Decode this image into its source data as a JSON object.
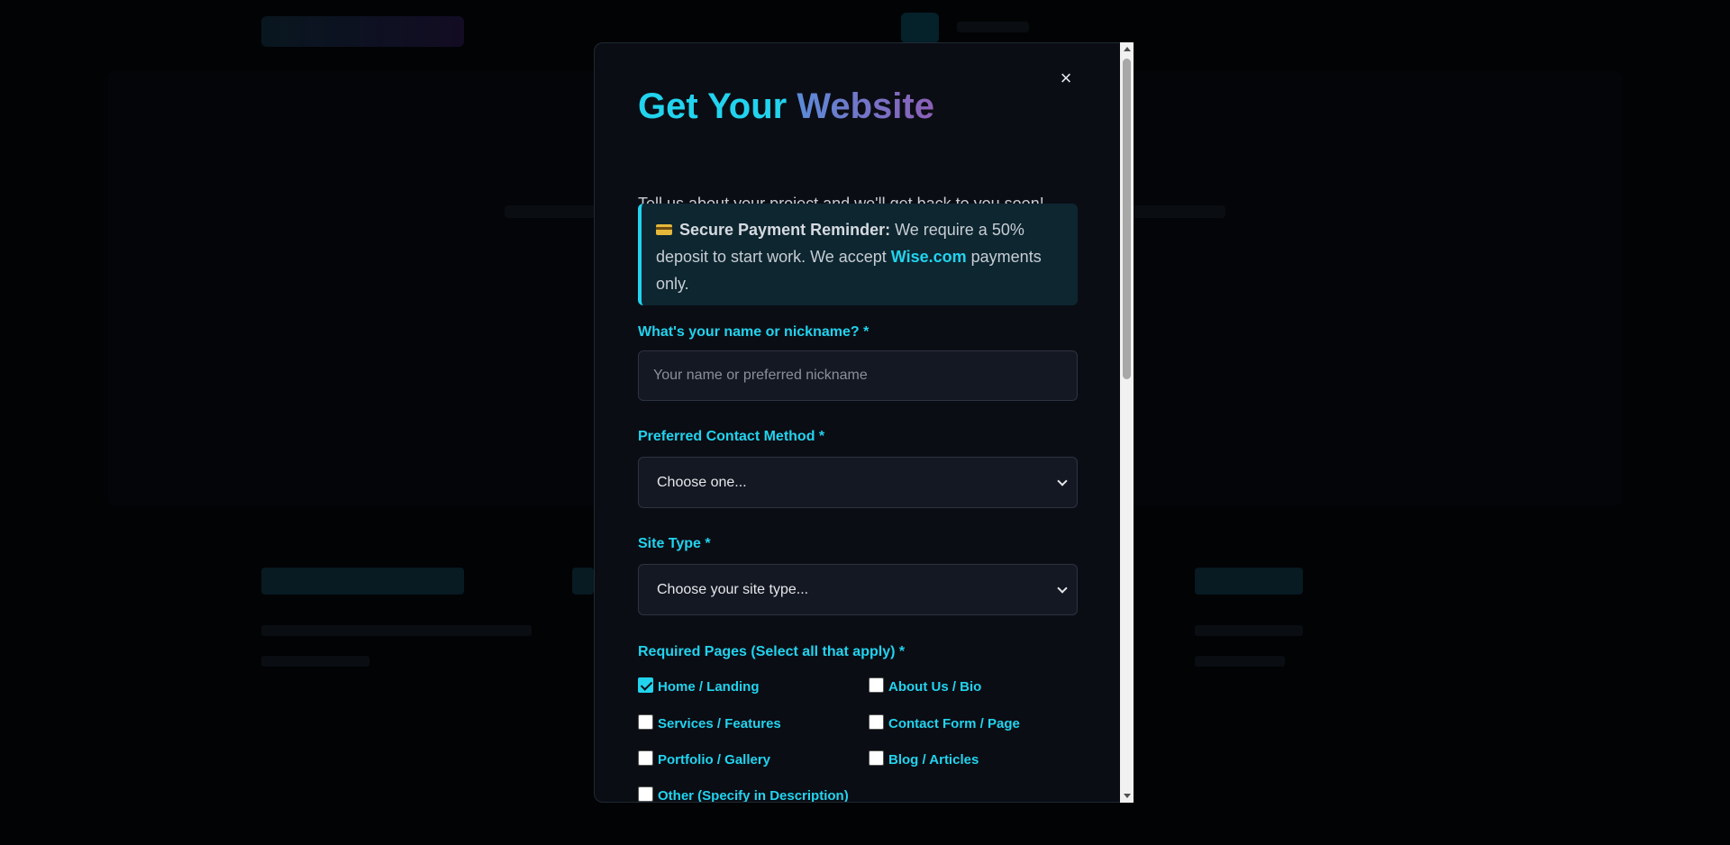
{
  "modal": {
    "title_part1": "Get Your",
    "title_part2": "Website",
    "subtitle": "Tell us about your project and we'll get back to you soon!",
    "close_label": "×",
    "notice": {
      "icon": "credit-card-icon",
      "heading": "Secure Payment Reminder:",
      "text_before": " We require a 50% deposit to start work. We accept ",
      "link": "Wise.com",
      "text_after": " payments only."
    },
    "name_field": {
      "label": "What's your name or nickname? *",
      "placeholder": "Your name or preferred nickname",
      "value": ""
    },
    "contact_method": {
      "label": "Preferred Contact Method *",
      "selected": "Choose one..."
    },
    "site_type": {
      "label": "Site Type *",
      "selected": "Choose your site type..."
    },
    "pages": {
      "label": "Required Pages (Select all that apply) *",
      "options": [
        {
          "label": "Home / Landing",
          "checked": true
        },
        {
          "label": "About Us / Bio",
          "checked": false
        },
        {
          "label": "Services / Features",
          "checked": false
        },
        {
          "label": "Contact Form / Page",
          "checked": false
        },
        {
          "label": "Portfolio / Gallery",
          "checked": false
        },
        {
          "label": "Blog / Articles",
          "checked": false
        },
        {
          "label": "Other (Specify in Description)",
          "checked": false
        }
      ]
    }
  },
  "colors": {
    "accent": "#22d3ee",
    "modal_bg": "#0b0d14",
    "notice_bg": "#0d2630"
  }
}
